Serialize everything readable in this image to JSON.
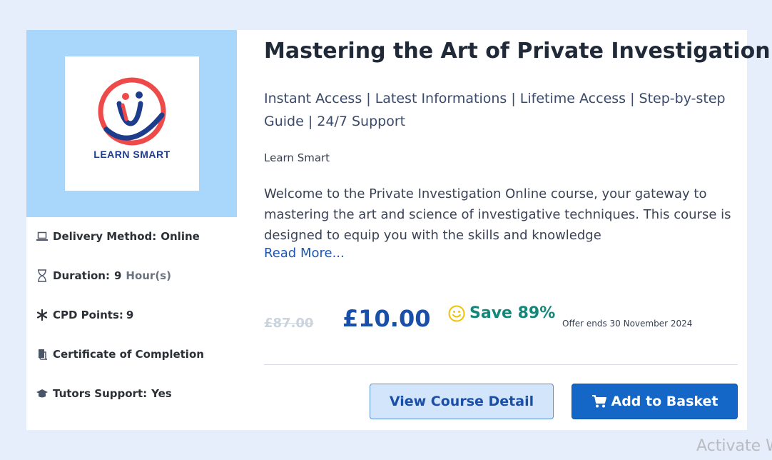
{
  "course": {
    "title": "Mastering the Art of Private Investigation",
    "features": "Instant Access | Latest Informations | Lifetime Access | Step-by-step Guide | 24/7 Support",
    "provider": "Learn Smart",
    "description": "Welcome to the Private Investigation Online course, your gateway to mastering the art and science of investigative techniques. This course is designed to equip you with the skills and knowledge",
    "read_more": "Read More..."
  },
  "logo": {
    "text": "LEARN SMART"
  },
  "meta": {
    "delivery_label": "Delivery Method:",
    "delivery_value": "Online",
    "duration_label": "Duration:",
    "duration_value": "9",
    "duration_unit": "Hour(s)",
    "cpd_label": "CPD Points:",
    "cpd_value": "9",
    "certificate_label": "Certificate of Completion",
    "tutors_label": "Tutors Support:",
    "tutors_value": "Yes"
  },
  "pricing": {
    "old_price": "£87.00",
    "price": "£10.00",
    "save": "Save 89%",
    "offer": "Offer ends 30 November 2024"
  },
  "buttons": {
    "view_detail": "View Course Detail",
    "add_basket": "Add to Basket"
  },
  "watermark": "Activate W",
  "colors": {
    "background": "#e6eefb",
    "logo_panel": "#a9d6fb",
    "price": "#1a4fa8",
    "save": "#12887a",
    "basket_button": "#1467c7"
  },
  "icons": [
    "laptop-icon",
    "hourglass-icon",
    "asterisk-icon",
    "certificate-icon",
    "graduation-cap-icon",
    "smile-icon",
    "cart-icon"
  ]
}
